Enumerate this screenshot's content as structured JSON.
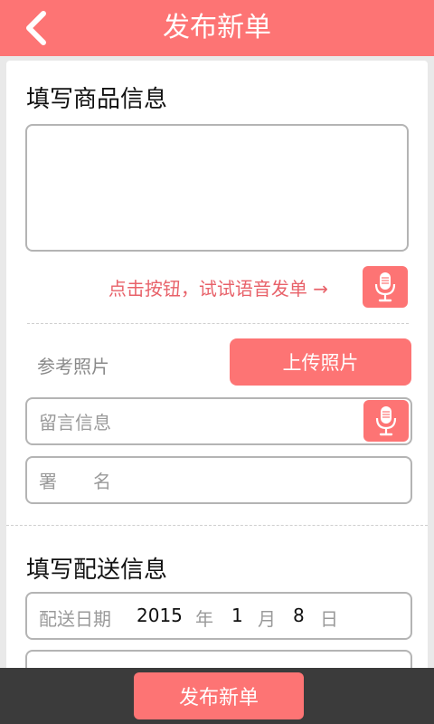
{
  "header": {
    "title": "发布新单",
    "back_icon": "chevron-left-icon"
  },
  "goods_section": {
    "title": "填写商品信息",
    "description_value": "",
    "voice_hint": "点击按钮，试试语音发单 →",
    "mic_icon": "microphone-icon"
  },
  "photo": {
    "label": "参考照片",
    "upload_button": "上传照片"
  },
  "message_field": {
    "placeholder": "留言信息",
    "mic_icon": "microphone-icon"
  },
  "signature_field": {
    "placeholder": "署　　名"
  },
  "delivery_section": {
    "title": "填写配送信息",
    "date_label": "配送日期",
    "year": "2015",
    "year_unit": "年",
    "month": "1",
    "month_unit": "月",
    "day": "8",
    "day_unit": "日"
  },
  "footer": {
    "publish_button": "发布新单"
  },
  "colors": {
    "accent": "#fd7474",
    "bottom_bar": "#3b3b3b",
    "hint_text": "#e8626a"
  }
}
